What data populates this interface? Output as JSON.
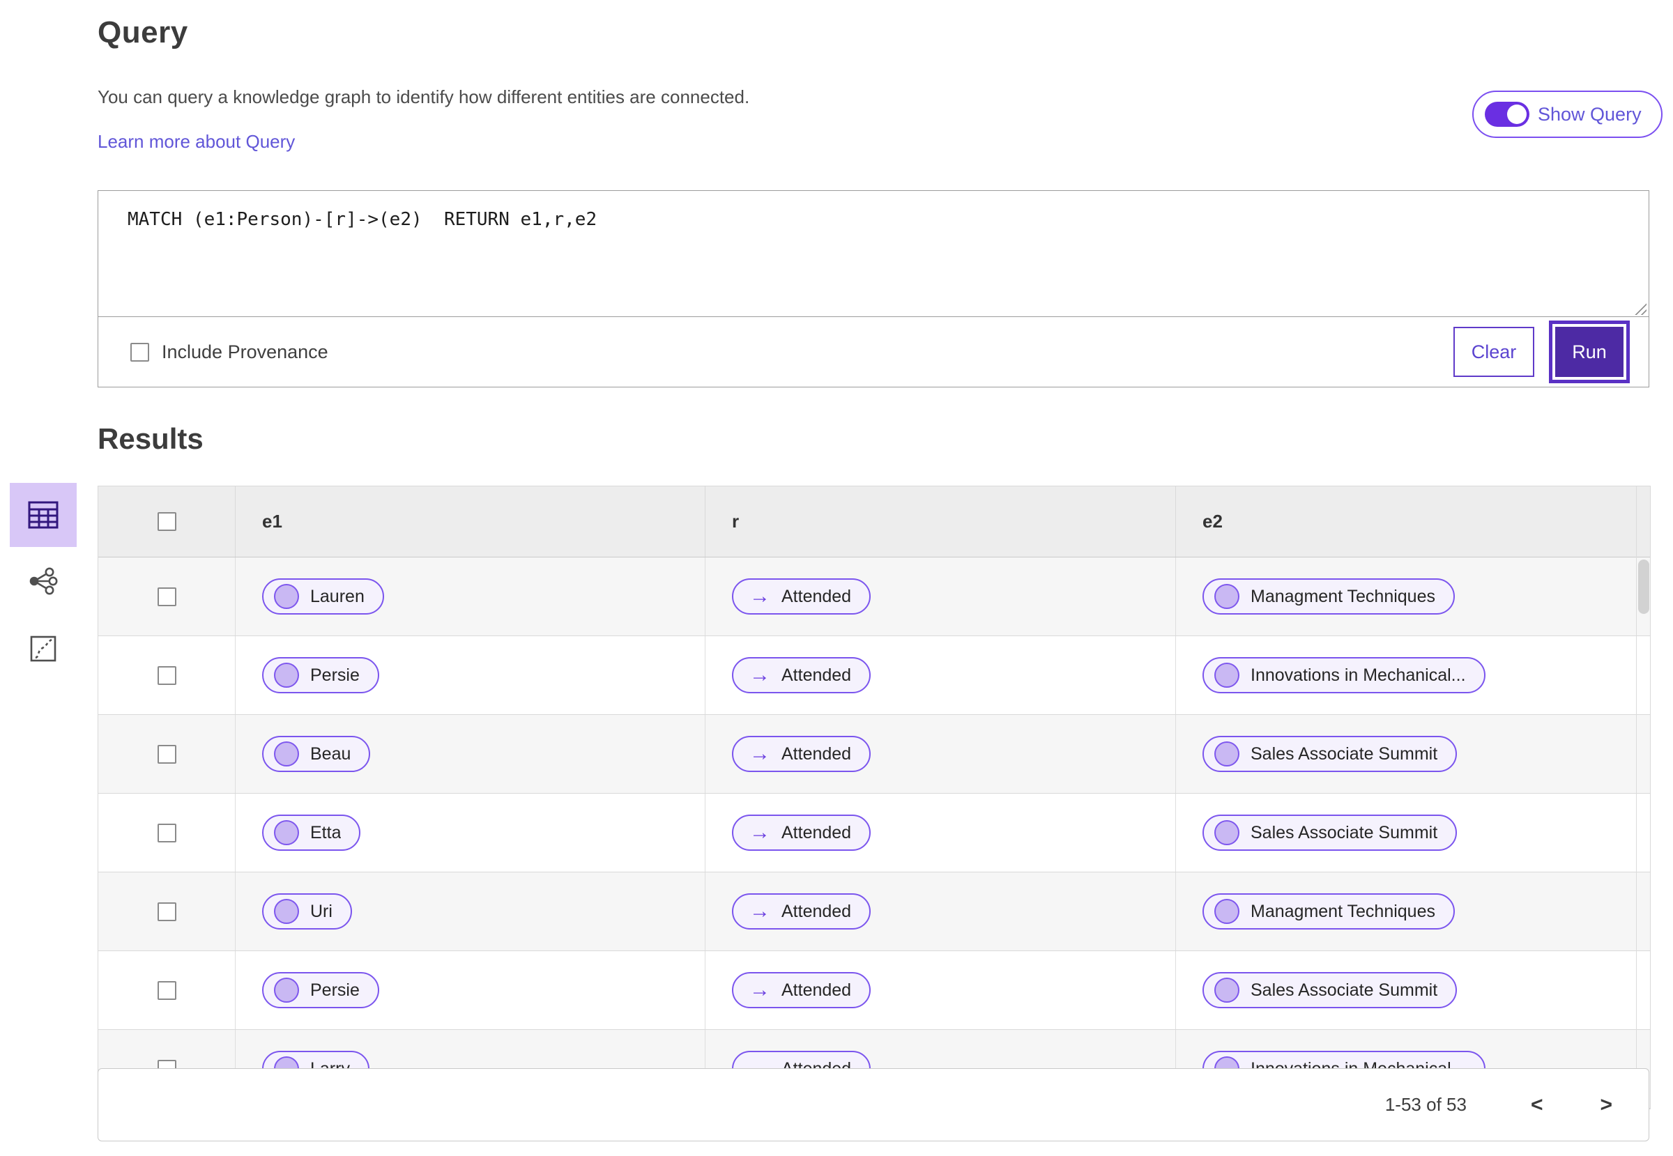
{
  "page": {
    "title": "Query",
    "description": "You can query a knowledge graph to identify how different entities are connected.",
    "learn_more_label": "Learn more about Query",
    "show_query_label": "Show Query",
    "show_query_on": true
  },
  "query_editor": {
    "query_text": "MATCH (e1:Person)-[r]->(e2)  RETURN e1,r,e2",
    "include_provenance_label": "Include Provenance",
    "include_provenance_checked": false,
    "clear_label": "Clear",
    "run_label": "Run"
  },
  "results": {
    "title": "Results",
    "view_switcher": [
      {
        "name": "table-view",
        "icon": "table-icon",
        "selected": true
      },
      {
        "name": "graph-view",
        "icon": "network-icon",
        "selected": false
      },
      {
        "name": "path-view",
        "icon": "route-icon",
        "selected": false
      }
    ],
    "table": {
      "columns": [
        "e1",
        "r",
        "e2"
      ],
      "rows": [
        {
          "e1": "Lauren",
          "r": "Attended",
          "e2": "Managment Techniques"
        },
        {
          "e1": "Persie",
          "r": "Attended",
          "e2": "Innovations in Mechanical..."
        },
        {
          "e1": "Beau",
          "r": "Attended",
          "e2": "Sales Associate Summit"
        },
        {
          "e1": "Etta",
          "r": "Attended",
          "e2": "Sales Associate Summit"
        },
        {
          "e1": "Uri",
          "r": "Attended",
          "e2": "Managment Techniques"
        },
        {
          "e1": "Persie",
          "r": "Attended",
          "e2": "Sales Associate Summit"
        },
        {
          "e1": "Larry",
          "r": "Attended",
          "e2": "Innovations in Mechanical..."
        }
      ]
    },
    "pagination": {
      "range_label": "1-53 of 53"
    }
  },
  "icons": {
    "relation_arrow": "→",
    "prev_chevron": "<",
    "next_chevron": ">"
  },
  "colors": {
    "accent_purple": "#6a2fe2",
    "run_button_bg": "#4d2aa4",
    "pill_border": "#7b55ee",
    "pill_bg": "#f5f2fd",
    "pill_circle": "#c9b8f3",
    "link": "#6156d8",
    "selected_view_bg": "#d8c7f7",
    "table_header_bg": "#ededed",
    "row_alt_bg": "#f6f6f6"
  }
}
